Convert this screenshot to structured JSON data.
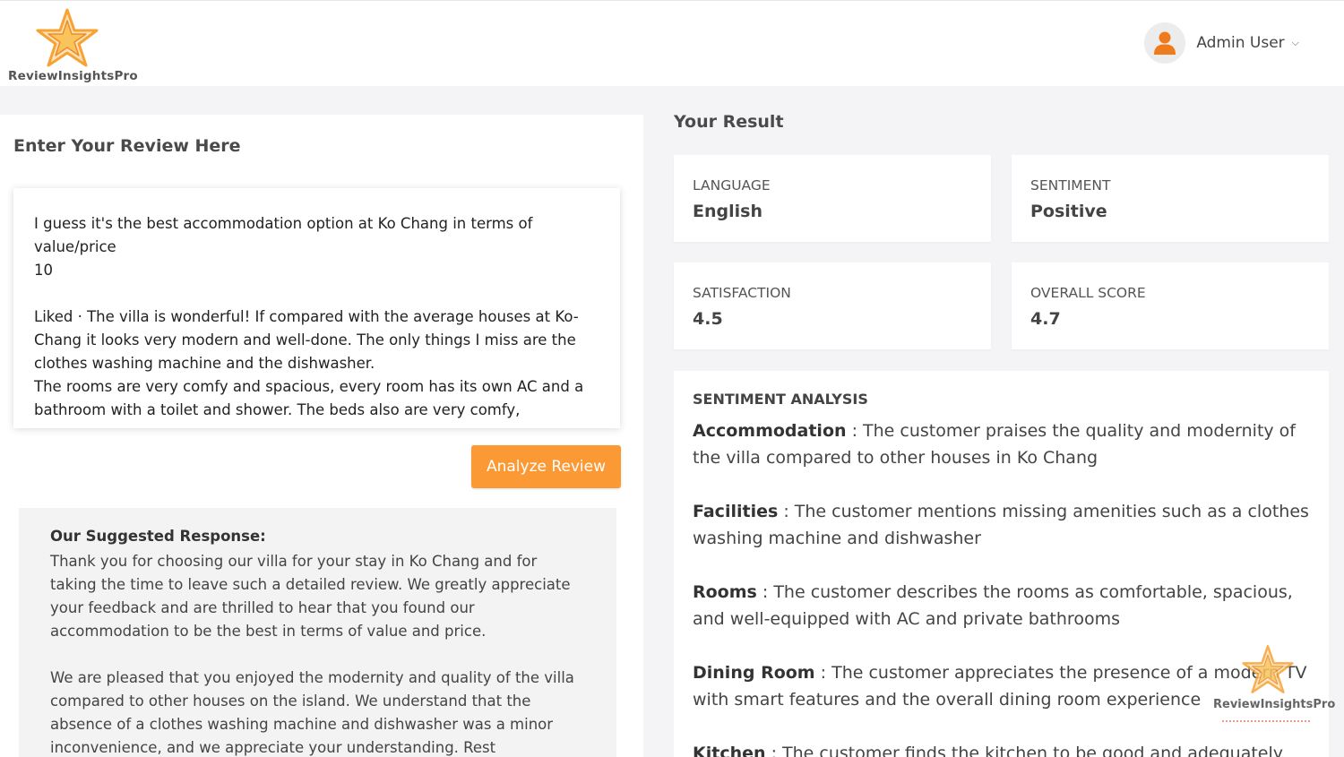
{
  "app": {
    "logo_text": "ReviewInsightsPro"
  },
  "header": {
    "user_name": "Admin User"
  },
  "review_panel": {
    "title": "Enter Your Review Here",
    "review_text": "I guess it's the best accommodation option at Ko Chang in terms of value/price\n10\n\nLiked · The villa is wonderful! If compared with the average houses at Ko-Chang it looks very modern and well-done. The only things I miss are the clothes washing machine and the dishwasher.\nThe rooms are very comfy and spacious, every room has its own AC and a bathroom with a toilet and shower. The beds also are very comfy,",
    "analyze_label": "Analyze Review"
  },
  "suggested": {
    "title": "Our Suggested Response:",
    "text": "Thank you for choosing our villa for your stay in Ko Chang and for taking the time to leave such a detailed review. We greatly appreciate your feedback and are thrilled to hear that you found our accommodation to be the best in terms of value and price.\n\nWe are pleased that you enjoyed the modernity and quality of the villa compared to other houses on the island. We understand that the absence of a clothes washing machine and dishwasher was a minor inconvenience, and we appreciate your understanding. Rest"
  },
  "result": {
    "title": "Your Result",
    "cards": [
      {
        "label": "LANGUAGE",
        "value": "English"
      },
      {
        "label": "SENTIMENT",
        "value": "Positive"
      },
      {
        "label": "SATISFACTION",
        "value": "4.5"
      },
      {
        "label": "OVERALL SCORE",
        "value": "4.7"
      }
    ]
  },
  "analysis": {
    "title": "SENTIMENT ANALYSIS",
    "items": [
      {
        "category": "Accommodation",
        "text": " : The customer praises the quality and modernity of the villa compared to other houses in Ko Chang"
      },
      {
        "category": "Facilities",
        "text": " : The customer mentions missing amenities such as a clothes washing machine and dishwasher"
      },
      {
        "category": "Rooms",
        "text": " : The customer describes the rooms as comfortable, spacious, and well-equipped with AC and private bathrooms"
      },
      {
        "category": "Dining Room",
        "text": " : The customer appreciates the presence of a modern TV with smart features and the overall dining room experience"
      },
      {
        "category": "Kitchen",
        "text": " : The customer finds the kitchen to be good and adequately"
      }
    ]
  },
  "watermark": {
    "text": "ReviewInsightsPro"
  },
  "colors": {
    "accent": "#fb9a35",
    "logo_star": "#f7a233"
  }
}
